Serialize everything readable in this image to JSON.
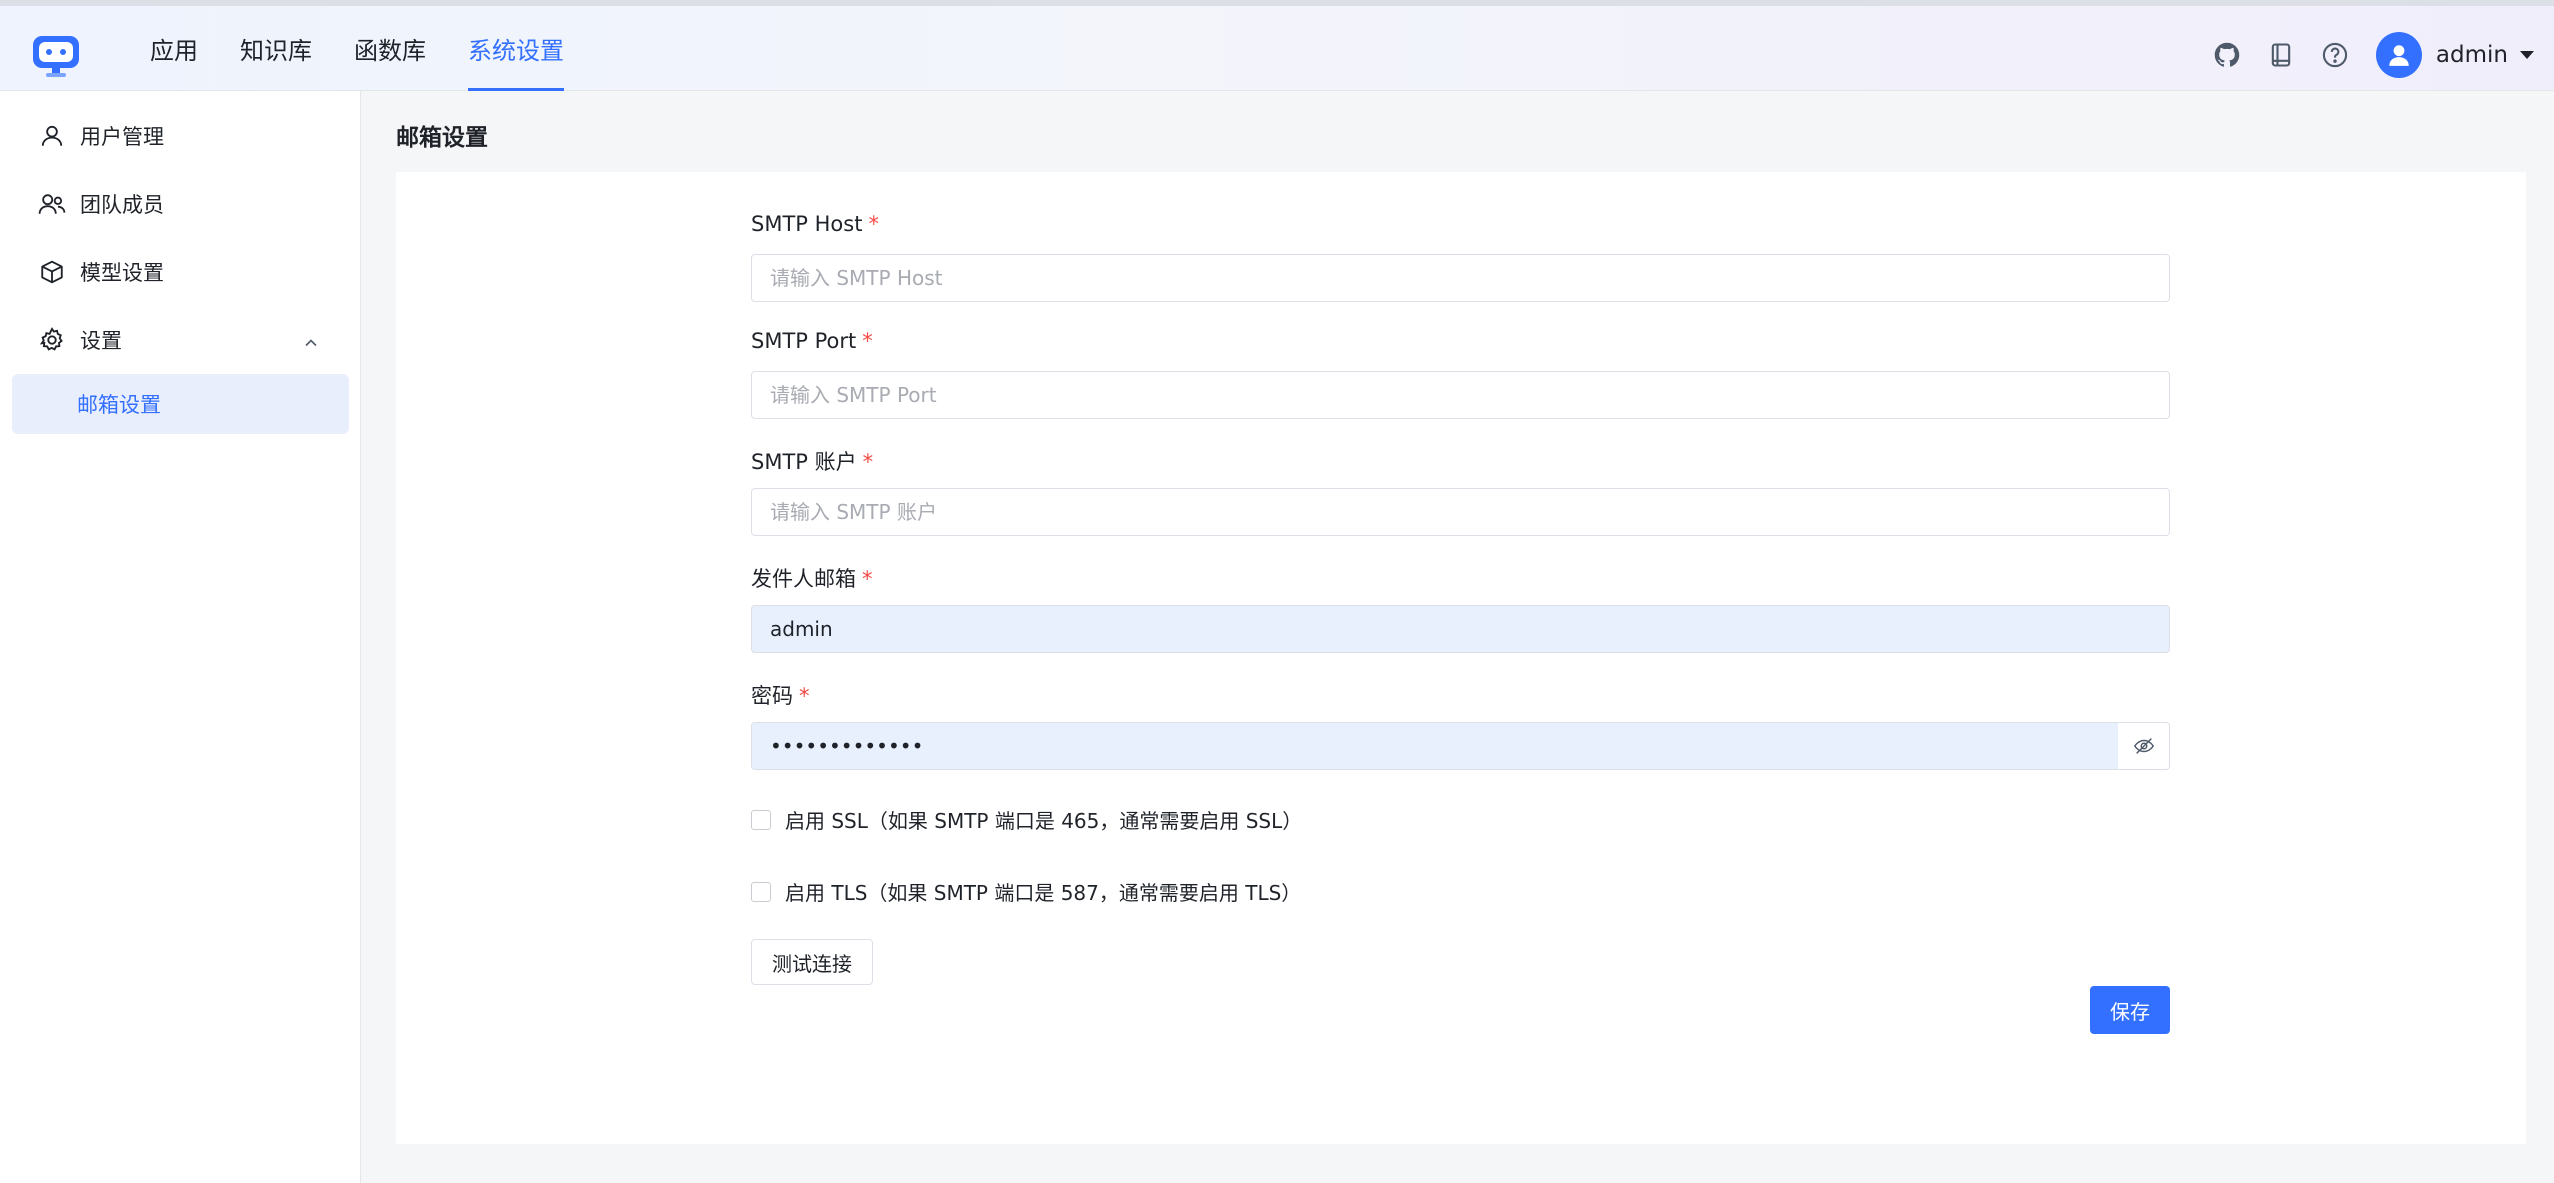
{
  "header": {
    "nav": [
      {
        "label": "应用"
      },
      {
        "label": "知识库"
      },
      {
        "label": "函数库"
      },
      {
        "label": "系统设置",
        "active": true
      }
    ],
    "icons": [
      "github-icon",
      "book-icon",
      "help-icon"
    ],
    "user": {
      "name": "admin"
    }
  },
  "sidebar": {
    "items": [
      {
        "label": "用户管理",
        "icon": "user-icon"
      },
      {
        "label": "团队成员",
        "icon": "team-icon"
      },
      {
        "label": "模型设置",
        "icon": "cube-icon"
      },
      {
        "label": "设置",
        "icon": "gear-icon",
        "expanded": true
      }
    ],
    "sub_item": {
      "label": "邮箱设置",
      "active": true
    }
  },
  "page": {
    "title": "邮箱设置"
  },
  "form": {
    "smtp_host": {
      "label": "SMTP Host",
      "required": "*",
      "placeholder": "请输入 SMTP Host",
      "value": ""
    },
    "smtp_port": {
      "label": "SMTP Port",
      "required": "*",
      "placeholder": "请输入 SMTP Port",
      "value": ""
    },
    "smtp_account": {
      "label": "SMTP 账户",
      "required": "*",
      "placeholder": "请输入 SMTP 账户",
      "value": ""
    },
    "sender_email": {
      "label": "发件人邮箱",
      "required": "*",
      "value": "admin"
    },
    "password": {
      "label": "密码",
      "required": "*",
      "value": "•••••••••••••"
    },
    "ssl": {
      "label": "启用 SSL（如果 SMTP 端口是 465，通常需要启用 SSL）",
      "checked": false
    },
    "tls": {
      "label": "启用 TLS（如果 SMTP 端口是 587，通常需要启用 TLS）",
      "checked": false
    },
    "test_button": "测试连接",
    "save_button": "保存"
  },
  "colors": {
    "accent": "#3370ff",
    "required": "#f54a45",
    "autofill": "#e8f0fe"
  }
}
